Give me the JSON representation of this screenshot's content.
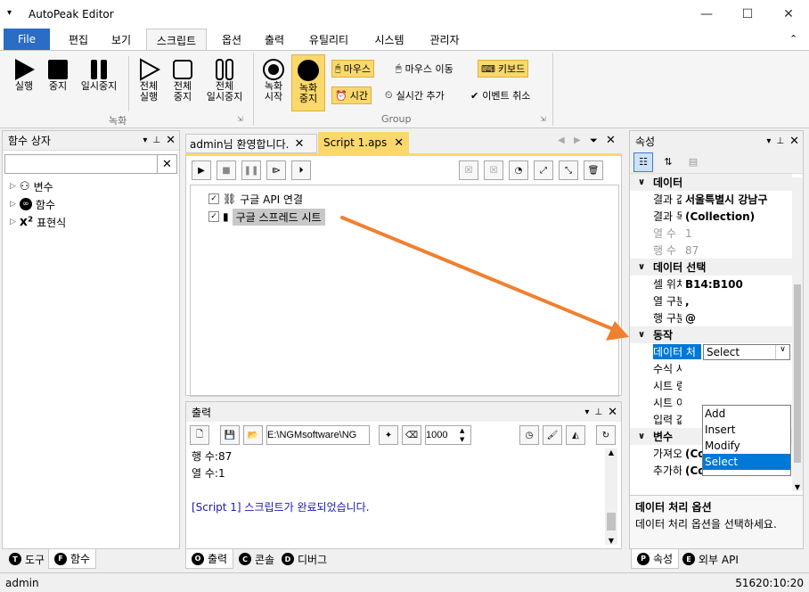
{
  "app": {
    "title": "AutoPeak Editor",
    "menu_icon": "triangle-down",
    "minimize": "—",
    "maximize": "☐",
    "close": "✕"
  },
  "ribbon_tabs": [
    "File",
    "편집",
    "보기",
    "스크립트",
    "옵션",
    "출력",
    "유틸리티",
    "시스템",
    "관리자"
  ],
  "ribbon": {
    "record_group": {
      "label": "녹화",
      "buttons": [
        {
          "label": "실행"
        },
        {
          "label": "중지"
        },
        {
          "label": "일시중지"
        },
        {
          "label": "전체\n실행"
        },
        {
          "label": "전체\n중지"
        },
        {
          "label": "전체\n일시중지"
        }
      ]
    },
    "group2": {
      "label": "Group",
      "buttons": [
        {
          "label": "녹화\n시작"
        },
        {
          "label": "녹화\n중지"
        }
      ],
      "options": [
        {
          "label": "마우스",
          "active": true
        },
        {
          "label": "마우스 이동",
          "active": false
        },
        {
          "label": "키보드",
          "active": true
        },
        {
          "label": "시간",
          "active": true
        },
        {
          "label": "실시간 추가",
          "active": false
        },
        {
          "label": "이벤트 취소",
          "active": false
        }
      ]
    }
  },
  "left_panel": {
    "title": "함수 상자",
    "search_value": "",
    "tree": [
      {
        "label": "변수",
        "icon": "variable-icon"
      },
      {
        "label": "함수",
        "icon": "infinity-icon"
      },
      {
        "label": "표현식",
        "icon": "x-squared-icon"
      }
    ],
    "tabs": [
      {
        "key": "T",
        "label": "도구"
      },
      {
        "key": "F",
        "label": "함수"
      }
    ]
  },
  "doc_tabs": [
    {
      "label": "admin님 환영합니다."
    },
    {
      "label": "Script 1.aps"
    }
  ],
  "script_items": [
    {
      "label": "구글 API 연결",
      "checked": true
    },
    {
      "label": "구글 스프레드 시트",
      "checked": true,
      "selected": true
    }
  ],
  "output": {
    "title": "출력",
    "path": "E:\\NGMsoftware\\NG",
    "number": "1000",
    "lines": [
      {
        "text": "행 수:87",
        "blue": false
      },
      {
        "text": "열 수:1",
        "blue": false
      },
      {
        "text": "",
        "blue": false
      },
      {
        "text": "[Script 1] 스크립트가 완료되었습니다.",
        "blue": true
      }
    ],
    "tabs": [
      {
        "key": "O",
        "label": "출력"
      },
      {
        "key": "C",
        "label": "콘솔"
      },
      {
        "key": "D",
        "label": "디버그"
      }
    ]
  },
  "properties": {
    "title": "속성",
    "categories": [
      {
        "name": "데이터",
        "rows": [
          {
            "k": "결과 값",
            "v": "서울특별시 강남구",
            "gray": false
          },
          {
            "k": "결과 목록",
            "v": "(Collection)",
            "gray": false
          },
          {
            "k": "열 수",
            "v": "1",
            "gray": true
          },
          {
            "k": "행 수",
            "v": "87",
            "gray": true
          }
        ]
      },
      {
        "name": "데이터 선택",
        "rows": [
          {
            "k": "셀 위치",
            "v": "B14:B100",
            "gray": false
          },
          {
            "k": "열 구분자",
            "v": ",",
            "gray": false
          },
          {
            "k": "행 구분자",
            "v": "@",
            "gray": false
          }
        ]
      },
      {
        "name": "동작",
        "rows": [
          {
            "k": "데이터 처",
            "v": "Select",
            "gray": false,
            "selected": true
          },
          {
            "k": "수식 사용",
            "v": "",
            "gray": false
          },
          {
            "k": "시트 링크",
            "v": "",
            "gray": false
          },
          {
            "k": "시트 이름",
            "v": "",
            "gray": false
          },
          {
            "k": "입력 값",
            "v": "",
            "gray": false
          }
        ]
      },
      {
        "name": "변수",
        "rows": [
          {
            "k": "가져오기",
            "v": "(Collection)",
            "gray": false
          },
          {
            "k": "추가하기",
            "v": "(Collection)",
            "gray": false
          }
        ]
      }
    ],
    "dropdown_options": [
      "Add",
      "Insert",
      "Modify",
      "Select"
    ],
    "dropdown_selected": "Select",
    "desc_title": "데이터 처리 옵션",
    "desc_text": "데이터 처리 옵션을 선택하세요.",
    "tabs": [
      {
        "key": "P",
        "label": "속성"
      },
      {
        "key": "E",
        "label": "외부 API"
      }
    ]
  },
  "status": {
    "left": "admin",
    "right": "51620:10:20"
  },
  "colors": {
    "accent": "#2b6cc4",
    "highlight": "#fbd86b",
    "arrow": "#f08030",
    "selection": "#0078d7"
  }
}
